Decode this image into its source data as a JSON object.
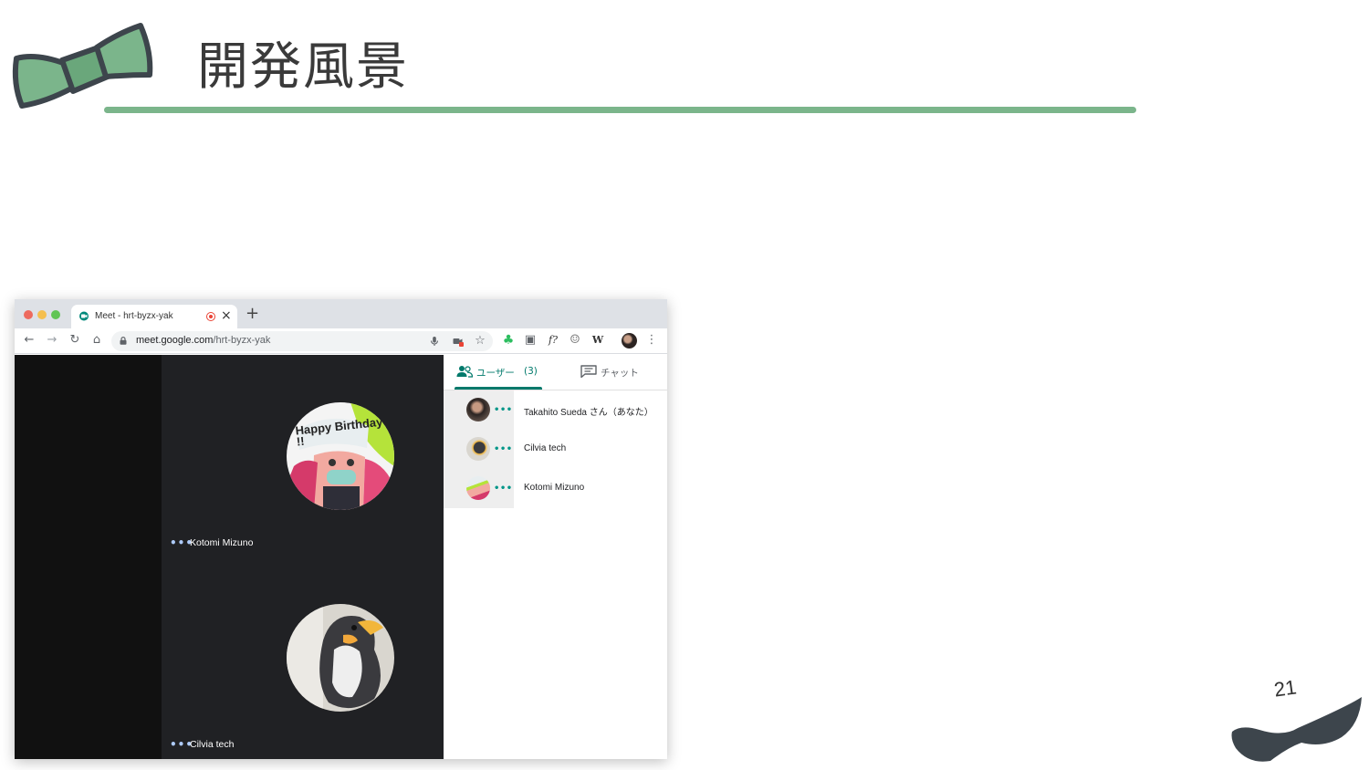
{
  "slide": {
    "title": "開発風景",
    "page_number": "21",
    "accent_color": "#7bb58b",
    "decor_top_left": "bowtie-icon",
    "decor_bottom_right": "mustache-icon"
  },
  "browser": {
    "tab": {
      "title": "Meet - hrt-byzx-yak",
      "favicon": "google-meet-icon",
      "recording_indicator": "recording-icon",
      "close": "×"
    },
    "new_tab": "+",
    "nav": {
      "back": "←",
      "forward": "→",
      "reload": "↻",
      "home": "⌂"
    },
    "url": {
      "host": "meet.google.com",
      "path": "/hrt-byzx-yak"
    },
    "omnibox_icons": [
      "microphone-icon",
      "camera-blocked-icon",
      "star-icon"
    ],
    "extensions": [
      {
        "name": "evernote-icon",
        "glyph": "♣"
      },
      {
        "name": "screen-share-icon",
        "glyph": "▣"
      },
      {
        "name": "function-icon",
        "glyph": "f?"
      },
      {
        "name": "ghost-icon",
        "glyph": "☺"
      },
      {
        "name": "wikipedia-icon",
        "glyph": "W"
      }
    ],
    "menu": "⋮"
  },
  "meet": {
    "tiles": [
      {
        "name": "Kotomi Mizuno",
        "avatar_text": "Happy Birthday !!",
        "dots": "•••"
      },
      {
        "name": "Cilvia tech",
        "dots": "•••"
      }
    ],
    "panel": {
      "users_tab": {
        "label": "ユーザー",
        "count": "(3)"
      },
      "chat_tab": {
        "label": "チャット"
      },
      "people": [
        {
          "name": "Takahito Sueda さん（あなた）",
          "dots": "•••"
        },
        {
          "name": "Cilvia tech",
          "dots": "•••"
        },
        {
          "name": "Kotomi Mizuno",
          "dots": "•••"
        }
      ]
    }
  }
}
